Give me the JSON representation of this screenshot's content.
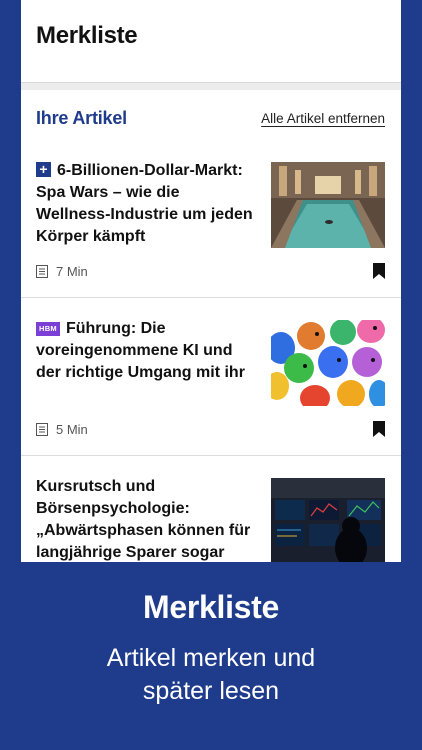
{
  "header": {
    "title": "Merkliste"
  },
  "section": {
    "title": "Ihre Artikel",
    "remove_all_label": "Alle Artikel entfernen"
  },
  "articles": [
    {
      "badge": "+",
      "title": "6-Billionen-Dollar-Markt: Spa Wars – wie die Wellness-Industrie um jeden Körper kämpft",
      "read_time": "7 Min",
      "bookmarked": true
    },
    {
      "badge": "HBM",
      "title": "Führung: Die voreingenommene KI und der richtige Umgang mit ihr",
      "read_time": "5 Min",
      "bookmarked": true
    },
    {
      "badge": "",
      "title": "Kursrutsch und Börsenpsychologie: „Abwärtsphasen können für langjährige Sparer sogar",
      "read_time": "",
      "bookmarked": false
    }
  ],
  "footer": {
    "title": "Merkliste",
    "subtitle_line1": "Artikel merken und",
    "subtitle_line2": "später lesen"
  },
  "colors": {
    "brand": "#1f3b8c",
    "hbm_badge": "#7b3fd6"
  }
}
